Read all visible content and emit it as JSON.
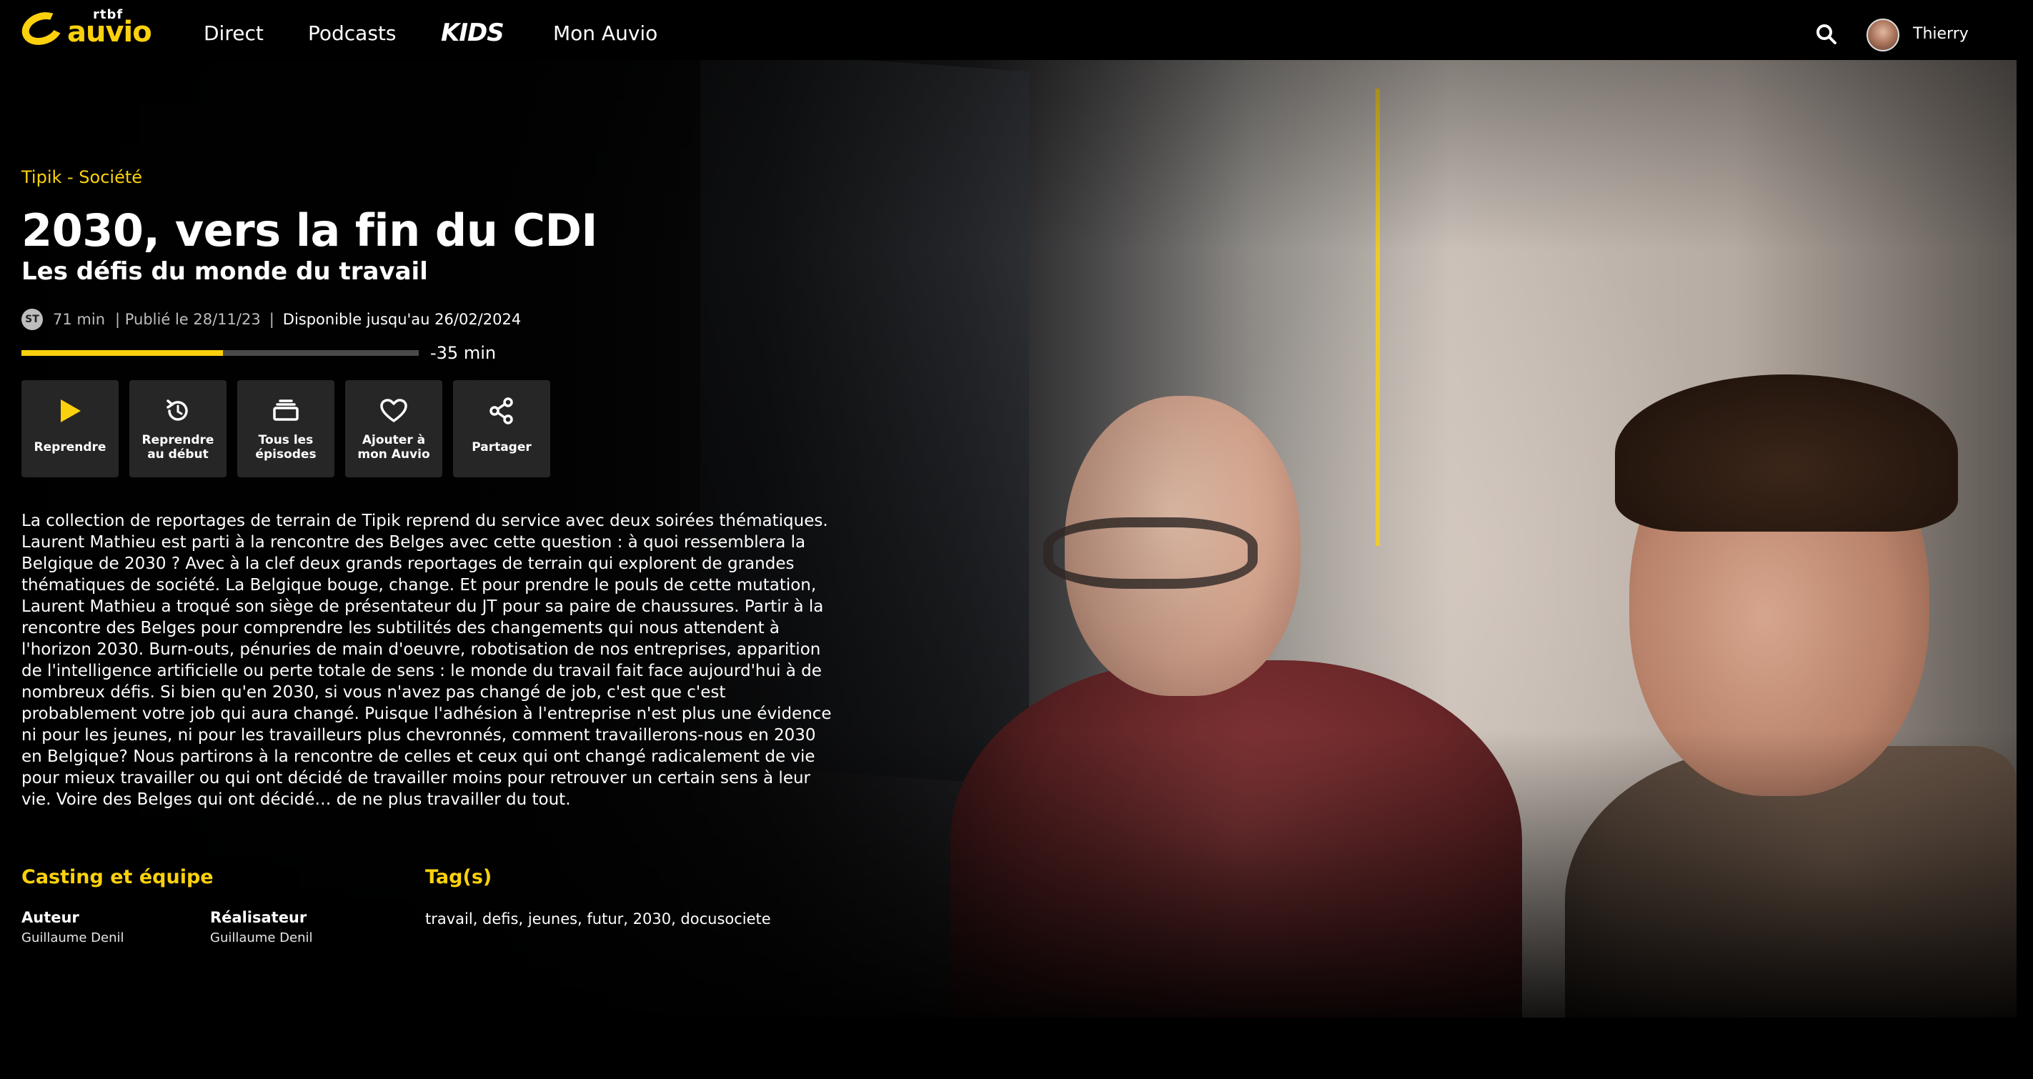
{
  "nav": {
    "logo_small": "rtbf",
    "logo_big": "auvio",
    "items": [
      {
        "label": "Direct"
      },
      {
        "label": "Podcasts"
      },
      {
        "label": "KIDS"
      },
      {
        "label": "Mon Auvio"
      }
    ],
    "user_name": "Thierry"
  },
  "program": {
    "breadcrumb": "Tipik - Société",
    "title": "2030, vers la fin du CDI",
    "subtitle": "Les défis du monde du travail",
    "subtitles_badge": "ST",
    "duration": "71 min",
    "published": "| Publié le 28/11/23",
    "separator": "|",
    "available_until": "Disponible jusqu'au 26/02/2024",
    "progress_fraction": 0.507,
    "remaining": "-35 min"
  },
  "actions": [
    {
      "label": "Reprendre",
      "icon": "play-icon"
    },
    {
      "label": "Reprendre\nau début",
      "icon": "restart-icon"
    },
    {
      "label": "Tous les\népisodes",
      "icon": "episodes-icon"
    },
    {
      "label": "Ajouter à\nmon Auvio",
      "icon": "heart-icon"
    },
    {
      "label": "Partager",
      "icon": "share-icon"
    }
  ],
  "description": "La collection de reportages de terrain de Tipik reprend du service avec deux soirées thématiques. Laurent Mathieu est parti à la rencontre des Belges avec cette question : à quoi ressemblera la Belgique de 2030 ? Avec à la clef deux grands reportages de terrain qui explorent de grandes thématiques de société. La Belgique bouge, change. Et pour prendre le pouls de cette mutation, Laurent Mathieu a troqué son siège de présentateur du JT pour sa paire de chaussures. Partir à la rencontre des Belges pour comprendre les subtilités des changements qui nous attendent à l'horizon 2030. Burn-outs, pénuries de main d'oeuvre, robotisation de nos entreprises, apparition de l'intelligence artificielle ou perte totale de sens : le monde du travail fait face aujourd'hui à de nombreux défis. Si bien qu'en 2030, si vous n'avez pas changé de job, c'est que c'est probablement votre job qui aura changé. Puisque l'adhésion à l'entreprise n'est plus une évidence ni pour les jeunes, ni pour les travailleurs plus chevronnés, comment travaillerons-nous en 2030 en Belgique? Nous partirons à la rencontre de celles et ceux qui ont changé radicalement de vie pour mieux travailler ou qui ont décidé de travailler moins pour retrouver un certain sens à leur vie. Voire des Belges qui ont décidé… de ne plus travailler du tout.",
  "casting": {
    "heading": "Casting et équipe",
    "members": [
      {
        "role": "Auteur",
        "name": "Guillaume Denil"
      },
      {
        "role": "Réalisateur",
        "name": "Guillaume Denil"
      }
    ]
  },
  "tags": {
    "heading": "Tag(s)",
    "text": "travail, defis, jeunes, futur, 2030, docusociete"
  },
  "colors": {
    "accent": "#fbd10d",
    "button_bg": "#262626",
    "background": "#000000"
  }
}
